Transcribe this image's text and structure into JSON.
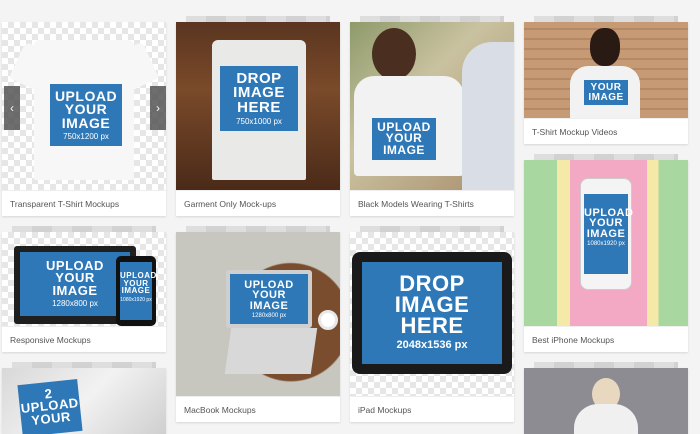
{
  "cards": [
    {
      "caption": "Transparent T-Shirt Mockups",
      "overlay": [
        "UPLOAD",
        "YOUR",
        "IMAGE"
      ],
      "size": "750x1200 px"
    },
    {
      "caption": "Garment Only Mock-ups",
      "overlay": [
        "DROP",
        "IMAGE",
        "HERE"
      ],
      "size": "750x1000 px"
    },
    {
      "caption": "Black Models Wearing T-Shirts",
      "overlay": [
        "UPLOAD",
        "YOUR",
        "IMAGE"
      ],
      "size": ""
    },
    {
      "caption": "T-Shirt Mockup Videos",
      "overlay": [
        "YOUR",
        "IMAGE"
      ],
      "size": ""
    },
    {
      "caption": "Best iPhone Mockups",
      "overlay": [
        "UPLOAD",
        "YOUR",
        "IMAGE"
      ],
      "size": "1080x1920 px"
    },
    {
      "caption": "Responsive Mockups",
      "overlay": [
        "UPLOAD",
        "YOUR",
        "IMAGE"
      ],
      "size": "1280x800 px",
      "overlay2": [
        "UPLOAD",
        "YOUR",
        "IMAGE"
      ],
      "size2": "1080x1920 px"
    },
    {
      "caption": "MacBook Mockups",
      "overlay": [
        "UPLOAD",
        "YOUR",
        "IMAGE"
      ],
      "size": "1280x800 px"
    },
    {
      "caption": "iPad Mockups",
      "overlay": [
        "DROP",
        "IMAGE",
        "HERE"
      ],
      "size": "2048x1536 px"
    },
    {
      "caption": "",
      "overlay": [
        "2",
        "UPLOAD",
        "YOUR"
      ],
      "size": ""
    }
  ],
  "carousel": {
    "prev": "‹",
    "next": "›"
  }
}
